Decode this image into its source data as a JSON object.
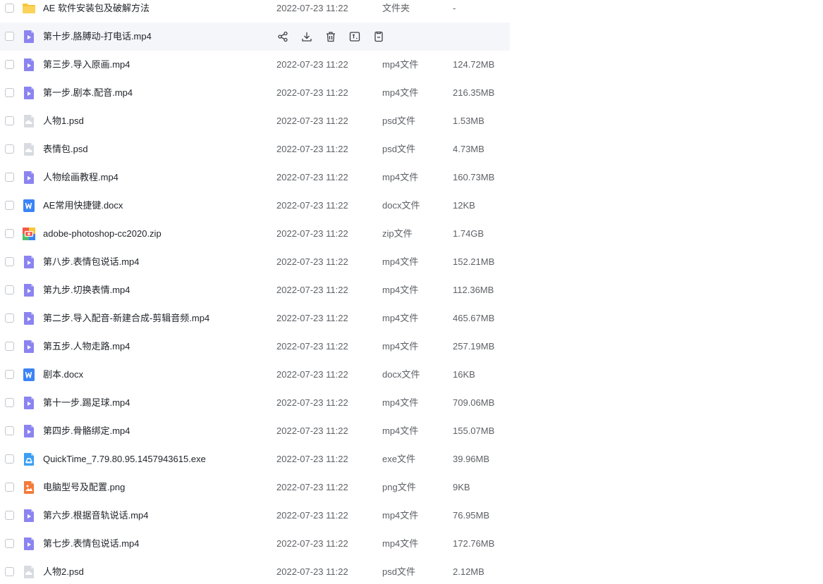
{
  "files": [
    {
      "name": "AE 软件安装包及破解方法",
      "date": "2022-07-23 11:22",
      "type": "文件夹",
      "size": "-",
      "icon": "folder-icon"
    },
    {
      "name": "第十步.胳膊动-打电话.mp4",
      "date": "",
      "type": "",
      "size": "",
      "icon": "video-file-icon",
      "hovered": true
    },
    {
      "name": "第三步.导入原画.mp4",
      "date": "2022-07-23 11:22",
      "type": "mp4文件",
      "size": "124.72MB",
      "icon": "video-file-icon"
    },
    {
      "name": "第一步.剧本.配音.mp4",
      "date": "2022-07-23 11:22",
      "type": "mp4文件",
      "size": "216.35MB",
      "icon": "video-file-icon"
    },
    {
      "name": "人物1.psd",
      "date": "2022-07-23 11:22",
      "type": "psd文件",
      "size": "1.53MB",
      "icon": "psd-file-icon"
    },
    {
      "name": "表情包.psd",
      "date": "2022-07-23 11:22",
      "type": "psd文件",
      "size": "4.73MB",
      "icon": "psd-file-icon"
    },
    {
      "name": "人物绘画教程.mp4",
      "date": "2022-07-23 11:22",
      "type": "mp4文件",
      "size": "160.73MB",
      "icon": "video-file-icon"
    },
    {
      "name": "AE常用快捷键.docx",
      "date": "2022-07-23 11:22",
      "type": "docx文件",
      "size": "12KB",
      "icon": "word-file-icon"
    },
    {
      "name": "adobe-photoshop-cc2020.zip",
      "date": "2022-07-23 11:22",
      "type": "zip文件",
      "size": "1.74GB",
      "icon": "zip-file-icon"
    },
    {
      "name": "第八步.表情包说话.mp4",
      "date": "2022-07-23 11:22",
      "type": "mp4文件",
      "size": "152.21MB",
      "icon": "video-file-icon"
    },
    {
      "name": "第九步.切换表情.mp4",
      "date": "2022-07-23 11:22",
      "type": "mp4文件",
      "size": "112.36MB",
      "icon": "video-file-icon"
    },
    {
      "name": "第二步.导入配音-新建合成-剪辑音频.mp4",
      "date": "2022-07-23 11:22",
      "type": "mp4文件",
      "size": "465.67MB",
      "icon": "video-file-icon"
    },
    {
      "name": "第五步.人物走路.mp4",
      "date": "2022-07-23 11:22",
      "type": "mp4文件",
      "size": "257.19MB",
      "icon": "video-file-icon"
    },
    {
      "name": "剧本.docx",
      "date": "2022-07-23 11:22",
      "type": "docx文件",
      "size": "16KB",
      "icon": "word-file-icon"
    },
    {
      "name": "第十一步.踢足球.mp4",
      "date": "2022-07-23 11:22",
      "type": "mp4文件",
      "size": "709.06MB",
      "icon": "video-file-icon"
    },
    {
      "name": "第四步.骨骼绑定.mp4",
      "date": "2022-07-23 11:22",
      "type": "mp4文件",
      "size": "155.07MB",
      "icon": "video-file-icon"
    },
    {
      "name": "QuickTime_7.79.80.95.1457943615.exe",
      "date": "2022-07-23 11:22",
      "type": "exe文件",
      "size": "39.96MB",
      "icon": "exe-file-icon"
    },
    {
      "name": "电脑型号及配置.png",
      "date": "2022-07-23 11:22",
      "type": "png文件",
      "size": "9KB",
      "icon": "image-file-icon"
    },
    {
      "name": "第六步.根据音轨说话.mp4",
      "date": "2022-07-23 11:22",
      "type": "mp4文件",
      "size": "76.95MB",
      "icon": "video-file-icon"
    },
    {
      "name": "第七步.表情包说话.mp4",
      "date": "2022-07-23 11:22",
      "type": "mp4文件",
      "size": "172.76MB",
      "icon": "video-file-icon"
    },
    {
      "name": "人物2.psd",
      "date": "2022-07-23 11:22",
      "type": "psd文件",
      "size": "2.12MB",
      "icon": "psd-file-icon"
    }
  ],
  "row_actions": [
    "share-icon",
    "download-icon",
    "delete-icon",
    "rename-icon",
    "more-icon"
  ],
  "colors": {
    "folder": "#f8c538",
    "video": "#8b84f0",
    "psd": "#d8dbe0",
    "word": "#3b83f6",
    "exe": "#3aa0f5",
    "image": "#f57a3a",
    "hover_bg": "#f5f6fa",
    "meta_text": "#5e6166"
  }
}
